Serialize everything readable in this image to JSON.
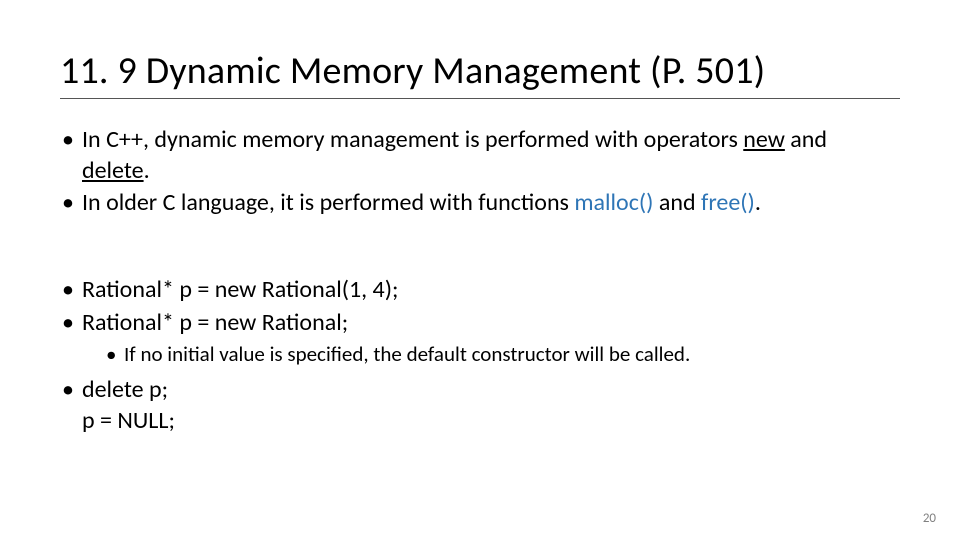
{
  "title": "11. 9 Dynamic Memory Management (P. 501)",
  "bullets": {
    "b1_pre": "In C++, dynamic memory management is performed with operators ",
    "b1_kw1": "new",
    "b1_mid": " and ",
    "b1_kw2": "delete",
    "b1_post": ".",
    "b2_pre": "In older C language, it is performed with functions ",
    "b2_fn1": "malloc()",
    "b2_mid": " and ",
    "b2_fn2": "free()",
    "b2_post": ".",
    "b3": "Rational* p = new Rational(1, 4);",
    "b4": "Rational* p = new Rational;",
    "b4_sub": "If no initial value is specified, the default constructor will be called.",
    "b5_l1": "delete p;",
    "b5_l2": "p = NULL;"
  },
  "page_number": "20"
}
